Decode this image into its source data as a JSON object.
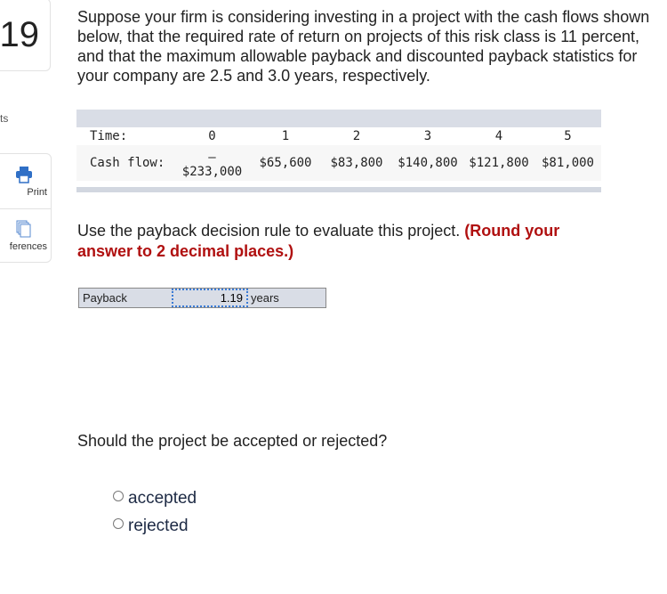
{
  "sidebar": {
    "question_number": "19",
    "points_label": "ts",
    "print_label": "Print",
    "references_label": "ferences"
  },
  "intro": "Suppose your firm is considering investing in a project with the cash flows shown below, that the required rate of return on projects of this risk class is 11 percent, and that the maximum allowable payback and discounted payback statistics for your company are 2.5 and 3.0 years, respectively.",
  "table": {
    "time_label": "Time:",
    "cash_label": "Cash flow:",
    "times": [
      "0",
      "1",
      "2",
      "3",
      "4",
      "5"
    ],
    "flows": [
      "–\n$233,000",
      "$65,600",
      "$83,800",
      "$140,800",
      "$121,800",
      "$81,000"
    ]
  },
  "instruction": "Use the payback decision rule to evaluate this project.",
  "instruction_note": "(Round your answer to 2 decimal places.)",
  "payback": {
    "label": "Payback",
    "value": "1.19",
    "unit": "years"
  },
  "question2": "Should the project be accepted or rejected?",
  "options": [
    "accepted",
    "rejected"
  ]
}
